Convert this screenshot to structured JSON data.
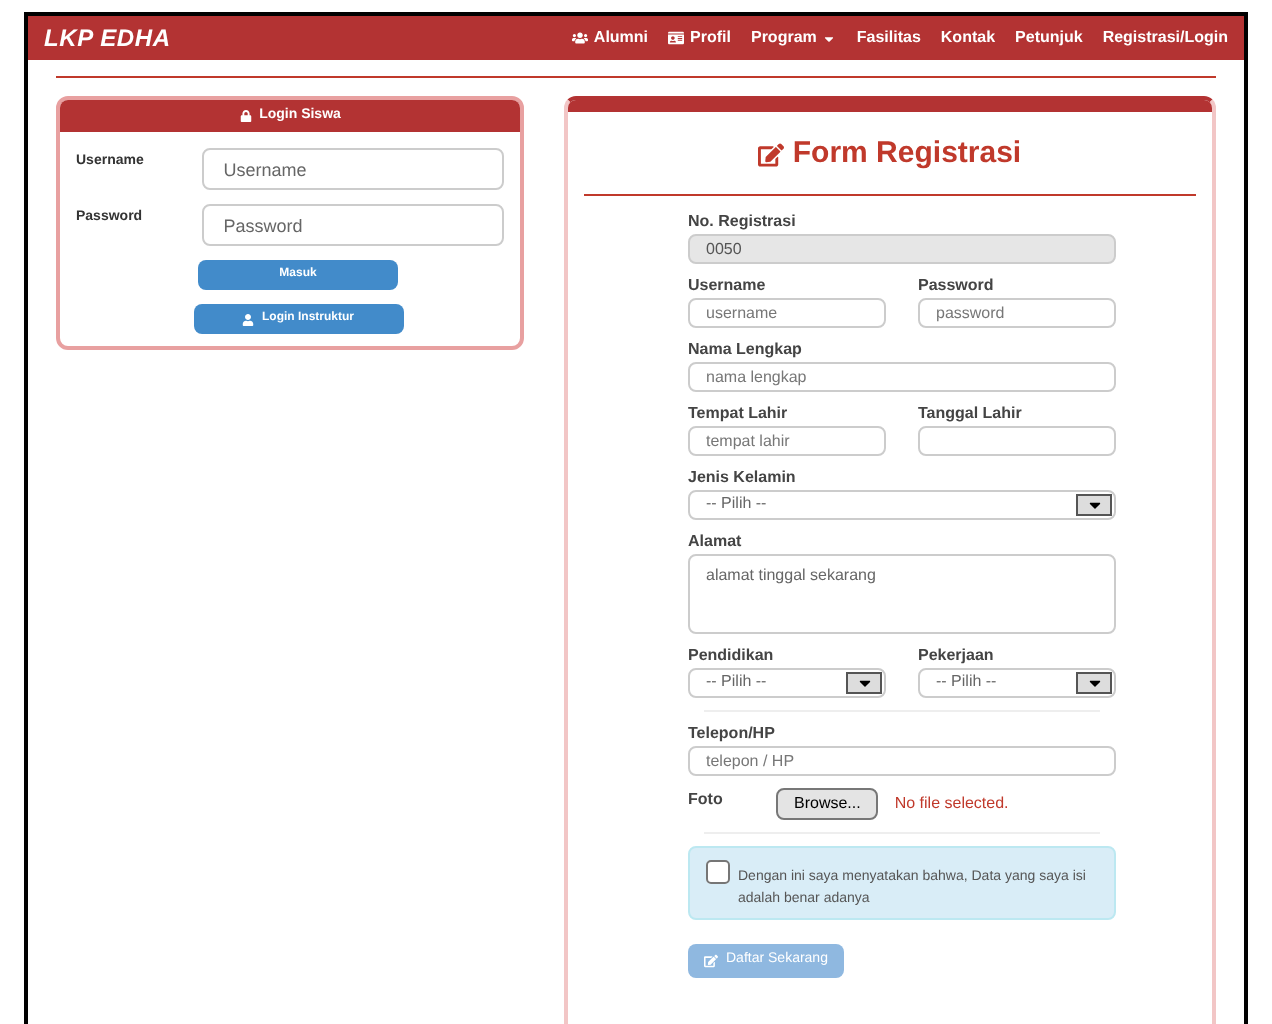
{
  "header": {
    "logo": "LKP EDHA",
    "nav": [
      {
        "label": "Alumni",
        "dropdown": false
      },
      {
        "label": "Profil",
        "dropdown": false
      },
      {
        "label": "Program",
        "dropdown": true
      },
      {
        "label": "Fasilitas",
        "dropdown": false
      },
      {
        "label": "Kontak",
        "dropdown": false
      },
      {
        "label": "Petunjuk",
        "dropdown": false
      },
      {
        "label": "Registrasi/Login",
        "dropdown": false
      }
    ]
  },
  "login": {
    "title": "Login Siswa",
    "fields": [
      {
        "label": "Username",
        "placeholder": "Username"
      },
      {
        "label": "Password",
        "placeholder": "Password"
      }
    ],
    "buttons": [
      "Masuk",
      "Login Instruktur"
    ]
  },
  "form": {
    "title": "Form Registrasi",
    "rows": [
      [
        {
          "kind": "input",
          "label": "No. Registrasi",
          "value": "0050",
          "disabled": true
        }
      ],
      [
        {
          "kind": "input",
          "label": "Username",
          "placeholder": "username",
          "disabled": false
        },
        {
          "kind": "input",
          "label": "Password",
          "placeholder": "password",
          "disabled": false
        }
      ],
      [
        {
          "kind": "input",
          "label": "Nama Lengkap",
          "placeholder": "nama lengkap",
          "disabled": false
        }
      ],
      [
        {
          "kind": "input",
          "label": "Tempat Lahir",
          "placeholder": "tempat lahir",
          "disabled": false
        },
        {
          "kind": "input",
          "label": "Tanggal Lahir",
          "disabled": false
        }
      ],
      [
        {
          "kind": "select",
          "label": "Jenis Kelamin",
          "value": "-- Pilih --"
        }
      ],
      [
        {
          "kind": "textarea",
          "label": "Alamat",
          "placeholder": "alamat tinggal sekarang"
        }
      ],
      [
        {
          "kind": "select",
          "label": "Pendidikan",
          "value": "-- Pilih --"
        },
        {
          "kind": "select",
          "label": "Pekerjaan",
          "value": "-- Pilih --"
        }
      ],
      [
        {
          "kind": "divider"
        }
      ],
      [
        {
          "kind": "input",
          "label": "Telepon/HP",
          "placeholder": "telepon / HP",
          "disabled": false
        }
      ],
      [
        {
          "kind": "file",
          "label": "Foto",
          "button": "Browse...",
          "status": "No file selected."
        }
      ],
      [
        {
          "kind": "divider"
        }
      ]
    ],
    "agreement": {
      "text": "Dengan ini saya menyatakan bahwa, Data yang saya isi adalah benar adanya",
      "checked": false
    },
    "submit": {
      "label": "Daftar Sekarang",
      "disabled": true
    }
  }
}
